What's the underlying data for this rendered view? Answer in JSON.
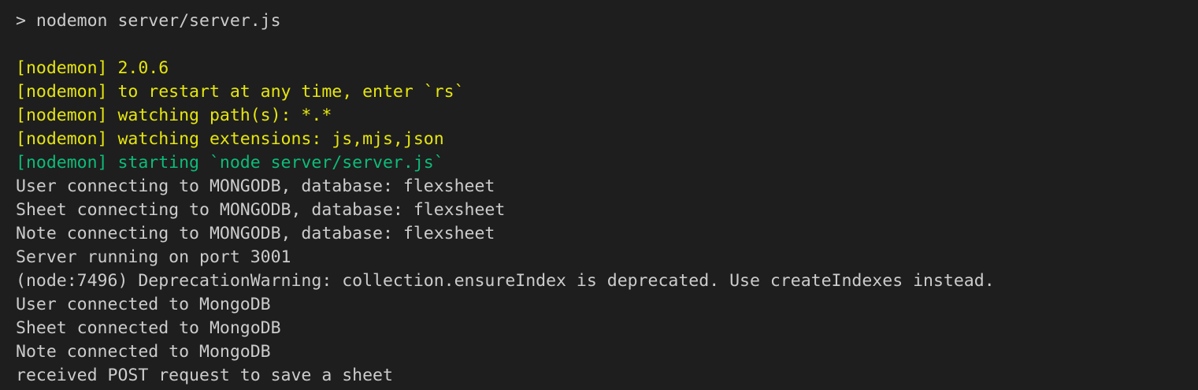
{
  "terminal": {
    "colors": {
      "background": "#1e1e1e",
      "default_text": "#cccccc",
      "nodemon_info": "#e5e510",
      "nodemon_start": "#0dbc79"
    },
    "command": "> nodemon server/server.js",
    "lines": [
      "[nodemon] 2.0.6",
      "[nodemon] to restart at any time, enter `rs`",
      "[nodemon] watching path(s): *.*",
      "[nodemon] watching extensions: js,mjs,json",
      "[nodemon] starting `node server/server.js`",
      "User connecting to MONGODB, database: flexsheet",
      "Sheet connecting to MONGODB, database: flexsheet",
      "Note connecting to MONGODB, database: flexsheet",
      "Server running on port 3001",
      "(node:7496) DeprecationWarning: collection.ensureIndex is deprecated. Use createIndexes instead.",
      "User connected to MongoDB",
      "Sheet connected to MongoDB",
      "Note connected to MongoDB",
      "received POST request to save a sheet"
    ]
  }
}
